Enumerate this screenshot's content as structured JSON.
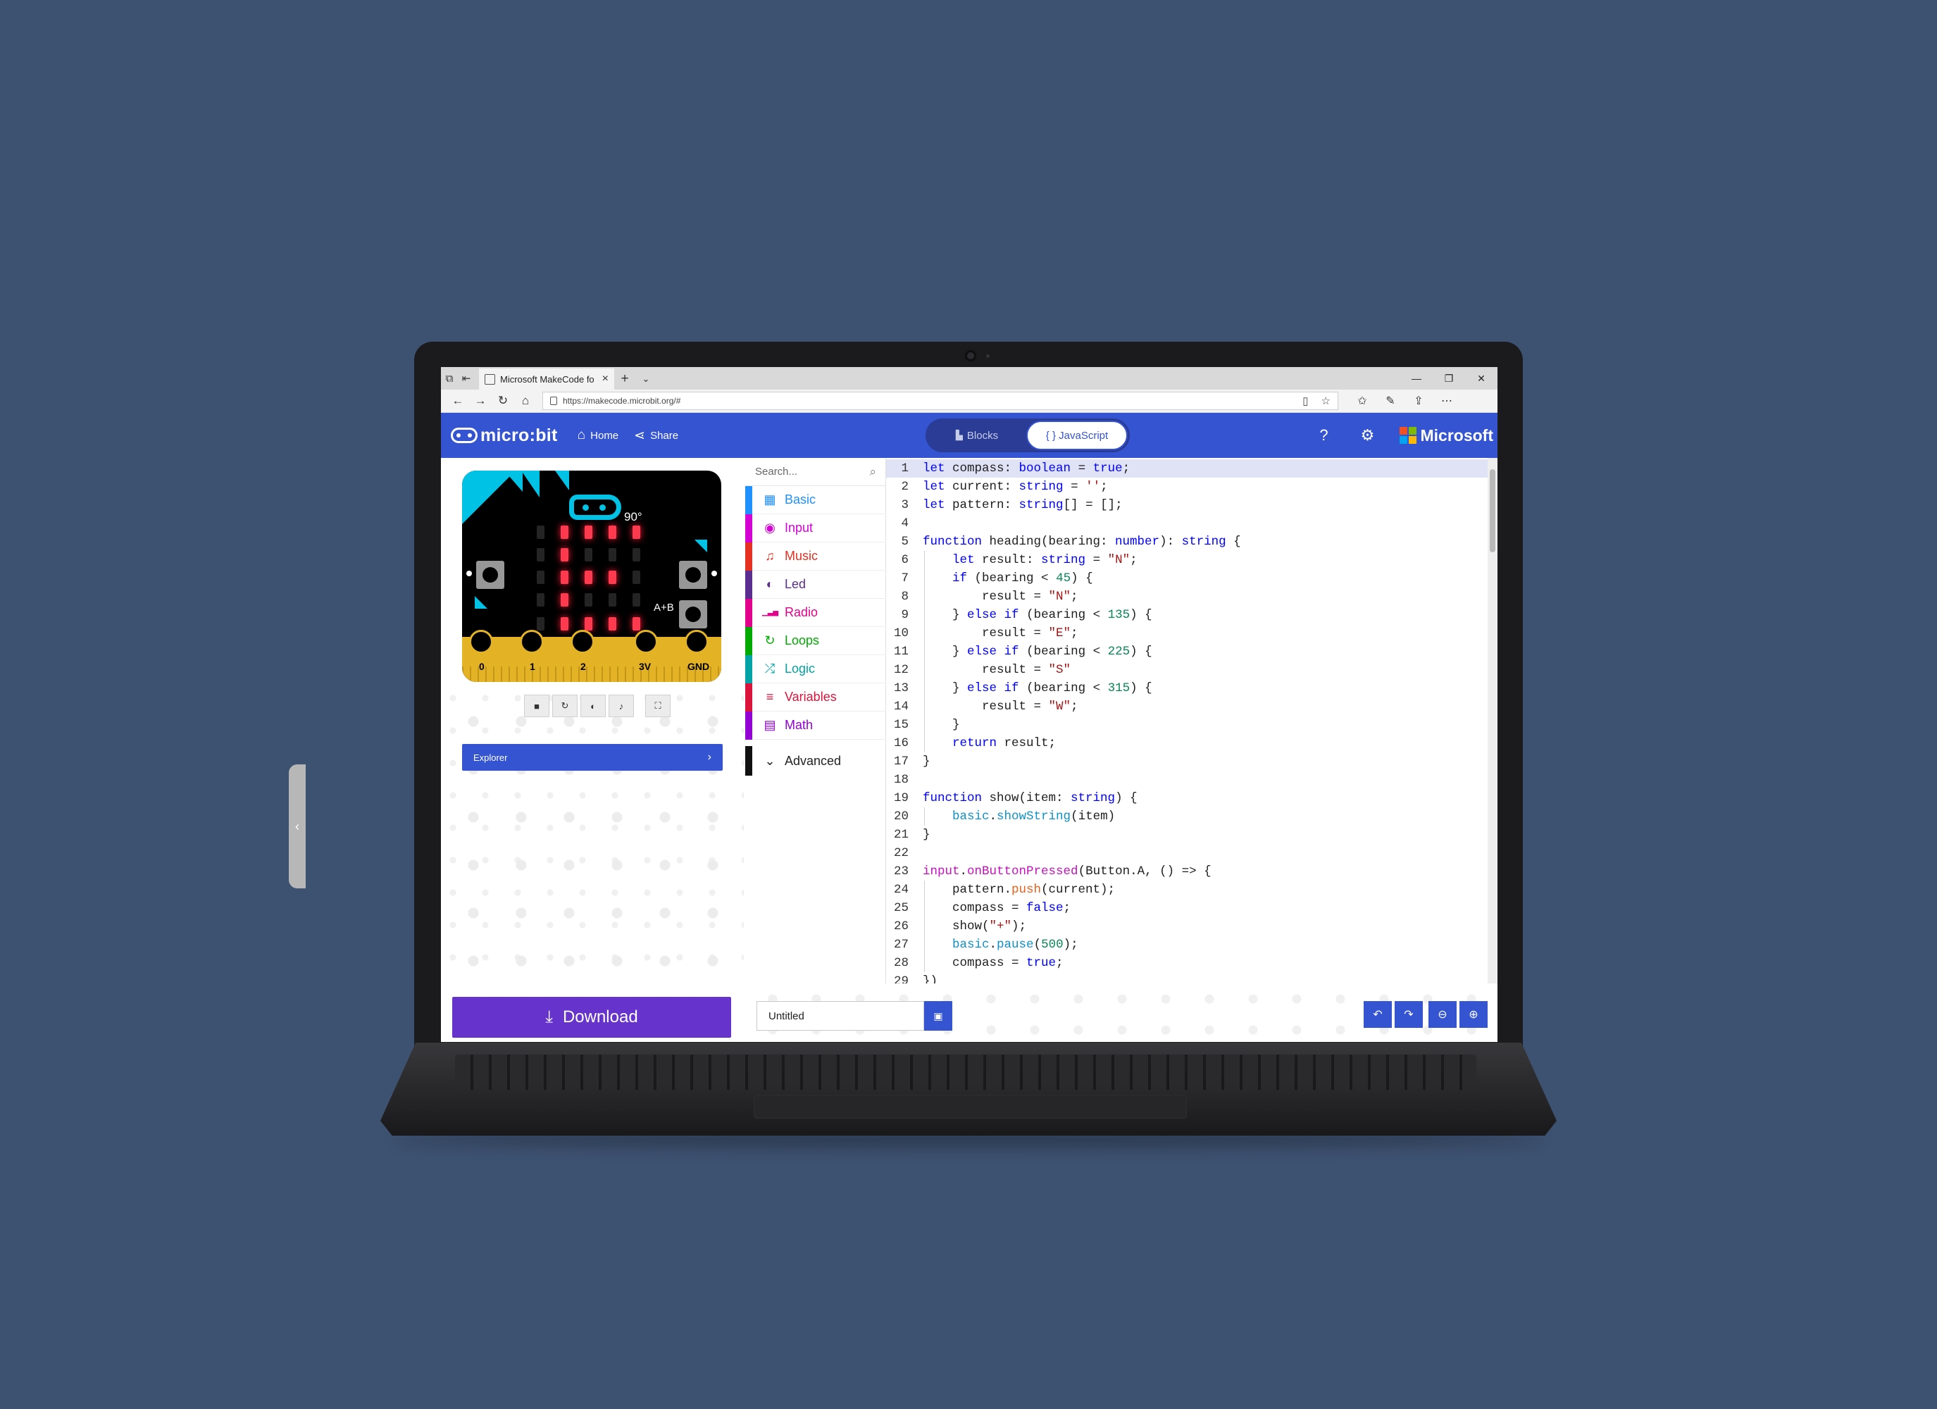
{
  "browser": {
    "tab_title": "Microsoft MakeCode fo",
    "url": "https://makecode.microbit.org/#"
  },
  "header": {
    "logo": "micro:bit",
    "home_label": "Home",
    "share_label": "Share",
    "toggle": {
      "blocks_label": "Blocks",
      "javascript_label": "{ } JavaScript",
      "selected": "JavaScript"
    },
    "brand": "Microsoft"
  },
  "simulator": {
    "compass_heading": "90°",
    "ab_label": "A+B",
    "led_matrix": [
      [
        0,
        1,
        1,
        1,
        1
      ],
      [
        0,
        1,
        0,
        0,
        0
      ],
      [
        0,
        1,
        1,
        1,
        0
      ],
      [
        0,
        1,
        0,
        0,
        0
      ],
      [
        0,
        1,
        1,
        1,
        1
      ]
    ],
    "pins": [
      "0",
      "1",
      "2",
      "3V",
      "GND"
    ],
    "explorer_label": "Explorer"
  },
  "toolbox": {
    "search_placeholder": "Search...",
    "categories": [
      {
        "label": "Basic",
        "color": "#1e90ff",
        "icon": "grid-icon",
        "glyph": "▦"
      },
      {
        "label": "Input",
        "color": "#d400d4",
        "icon": "target-icon",
        "glyph": "◉"
      },
      {
        "label": "Music",
        "color": "#e63022",
        "icon": "headphones-icon",
        "glyph": "♫"
      },
      {
        "label": "Led",
        "color": "#5c2d91",
        "icon": "toggle-icon",
        "glyph": "◐"
      },
      {
        "label": "Radio",
        "color": "#e3008c",
        "icon": "signal-icon",
        "glyph": "▁▃▅"
      },
      {
        "label": "Loops",
        "color": "#00aa00",
        "icon": "refresh-icon",
        "glyph": "↻"
      },
      {
        "label": "Logic",
        "color": "#00a4a6",
        "icon": "shuffle-icon",
        "glyph": "⤮"
      },
      {
        "label": "Variables",
        "color": "#dc143c",
        "icon": "list-icon",
        "glyph": "≡"
      },
      {
        "label": "Math",
        "color": "#9400d3",
        "icon": "calculator-icon",
        "glyph": "▤"
      }
    ],
    "advanced_label": "Advanced"
  },
  "editor": {
    "code_lines": [
      "let compass: boolean = true;",
      "let current: string = '';",
      "let pattern: string[] = [];",
      "",
      "function heading(bearing: number): string {",
      "    let result: string = \"N\";",
      "    if (bearing < 45) {",
      "        result = \"N\";",
      "    } else if (bearing < 135) {",
      "        result = \"E\";",
      "    } else if (bearing < 225) {",
      "        result = \"S\"",
      "    } else if (bearing < 315) {",
      "        result = \"W\";",
      "    }",
      "    return result;",
      "}",
      "",
      "function show(item: string) {",
      "    basic.showString(item)",
      "}",
      "",
      "input.onButtonPressed(Button.A, () => {",
      "    pattern.push(current);",
      "    compass = false;",
      "    show(\"+\");",
      "    basic.pause(500);",
      "    compass = true;",
      "})"
    ]
  },
  "footer": {
    "download_label": "Download",
    "project_name": "Untitled"
  }
}
